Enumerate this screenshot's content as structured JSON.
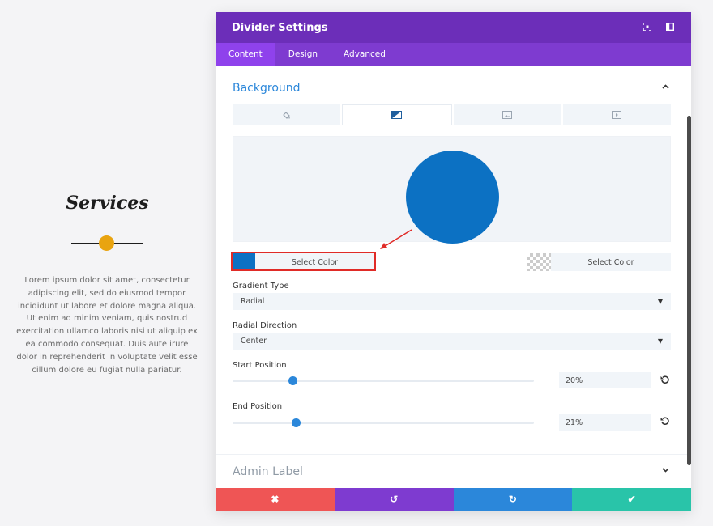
{
  "preview": {
    "title": "Services",
    "body": "Lorem ipsum dolor sit amet, consectetur adipiscing elit, sed do eiusmod tempor incididunt ut labore et dolore magna aliqua. Ut enim ad minim veniam, quis nostrud exercitation ullamco laboris nisi ut aliquip ex ea commodo consequat. Duis aute irure dolor in reprehenderit in voluptate velit esse cillum dolore eu fugiat nulla pariatur.",
    "accent_color": "#e9a410"
  },
  "modal": {
    "title": "Divider Settings",
    "header_icons": [
      "fullscreen-icon",
      "split-view-icon"
    ],
    "tabs": [
      {
        "label": "Content",
        "active": true
      },
      {
        "label": "Design",
        "active": false
      },
      {
        "label": "Advanced",
        "active": false
      }
    ],
    "background": {
      "section_title": "Background",
      "type_tabs": [
        "color-icon",
        "gradient-icon",
        "image-icon",
        "video-icon"
      ],
      "active_type": "gradient",
      "gradient_color": "#0c71c3",
      "start_color": {
        "label": "Select Color",
        "color": "#0c71c3"
      },
      "end_color": {
        "label": "Select Color",
        "color": "transparent"
      },
      "gradient_type": {
        "label": "Gradient Type",
        "value": "Radial"
      },
      "radial_direction": {
        "label": "Radial Direction",
        "value": "Center"
      },
      "start_position": {
        "label": "Start Position",
        "value": "20%",
        "fraction": 0.2
      },
      "end_position": {
        "label": "End Position",
        "value": "21%",
        "fraction": 0.21
      }
    },
    "admin_label": "Admin Label",
    "footer": {
      "cancel": "✖",
      "undo": "↺",
      "redo": "↻",
      "save": "✔"
    },
    "colors": {
      "header": "#6c2eb9",
      "tabs": "#7e3bd0",
      "accent": "#2b87da",
      "cancel": "#ef5555",
      "save": "#29c4a9"
    }
  }
}
